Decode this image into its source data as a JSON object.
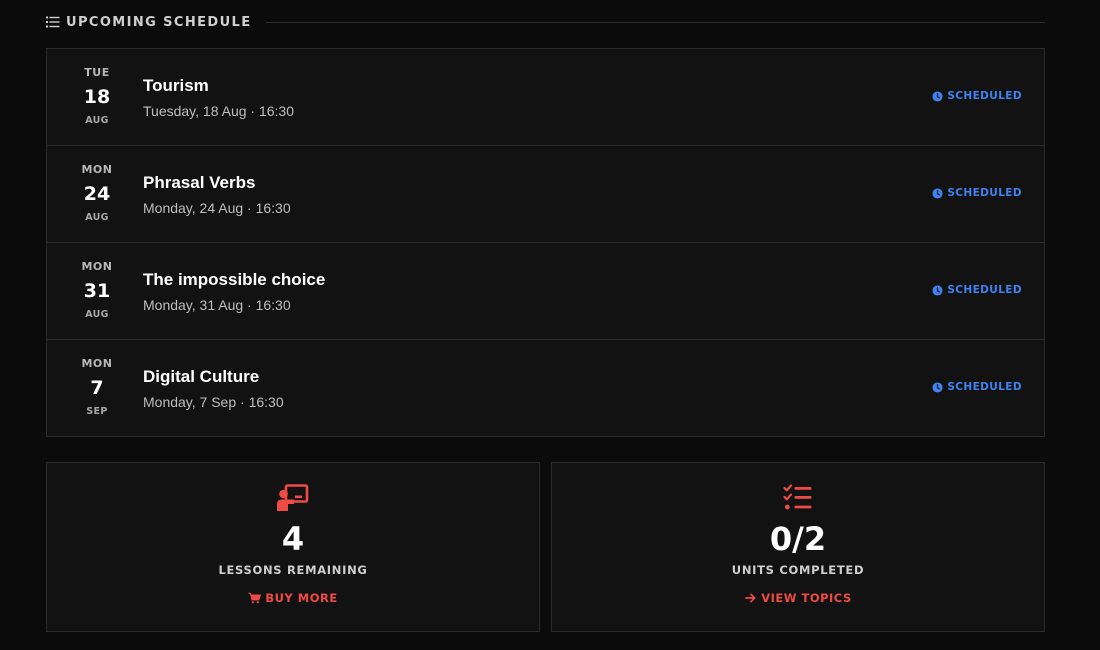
{
  "section": {
    "title": "UPCOMING SCHEDULE",
    "icon": "list-icon"
  },
  "schedule": [
    {
      "dow": "TUE",
      "day": "18",
      "month": "AUG",
      "title": "Tourism",
      "when": "Tuesday, 18 Aug · 16:30",
      "status": "SCHEDULED"
    },
    {
      "dow": "MON",
      "day": "24",
      "month": "AUG",
      "title": "Phrasal Verbs",
      "when": "Monday, 24 Aug · 16:30",
      "status": "SCHEDULED"
    },
    {
      "dow": "MON",
      "day": "31",
      "month": "AUG",
      "title": "The impossible choice",
      "when": "Monday, 31 Aug · 16:30",
      "status": "SCHEDULED"
    },
    {
      "dow": "MON",
      "day": "7",
      "month": "SEP",
      "title": "Digital Culture",
      "when": "Monday, 7 Sep · 16:30",
      "status": "SCHEDULED"
    }
  ],
  "stats": {
    "lessons": {
      "value": "4",
      "label": "LESSONS REMAINING",
      "link": "BUY MORE",
      "icon": "teacher-board-icon",
      "link_icon": "cart-icon"
    },
    "units": {
      "value": "0/2",
      "label": "UNITS COMPLETED",
      "link": "VIEW TOPICS",
      "icon": "checklist-icon",
      "link_icon": "arrow-right-icon"
    }
  },
  "colors": {
    "accent": "#ef4a45",
    "status": "#3f82f2",
    "background": "#0b0b0b",
    "panel": "#121212"
  }
}
